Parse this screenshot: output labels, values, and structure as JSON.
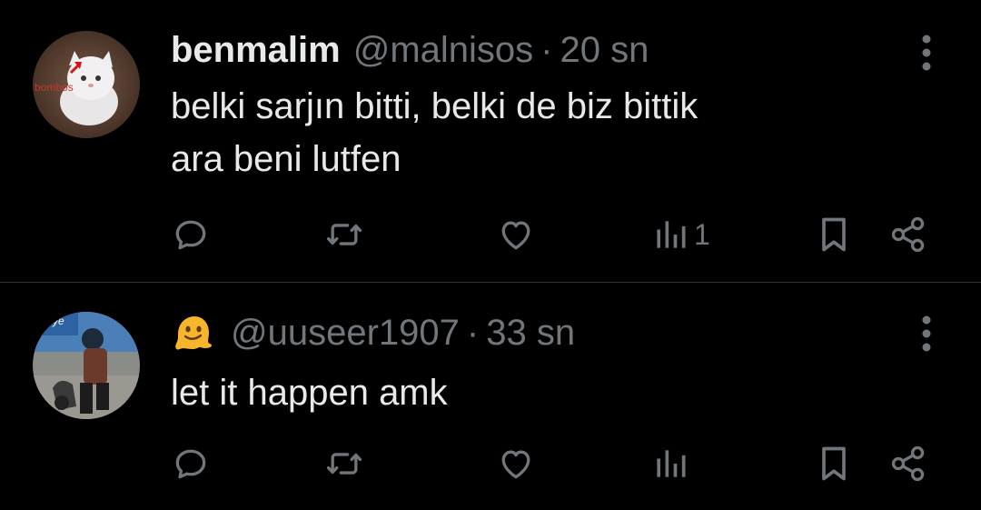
{
  "colors": {
    "background": "#000000",
    "text_primary": "#e7e9ea",
    "text_secondary": "#71767b",
    "divider": "#2f3336"
  },
  "tweets": [
    {
      "display_name": "benmalim",
      "handle": "@malnisos",
      "separator": "·",
      "time": "20 sn",
      "avatar_text": "bombos",
      "body": [
        "belki sarjın bitti, belki de biz bittik",
        "ara beni lutfen"
      ],
      "views": "1",
      "icons": [
        "reply-icon",
        "retweet-icon",
        "like-icon",
        "views-icon",
        "bookmark-icon",
        "share-icon",
        "more-icon"
      ]
    },
    {
      "display_name_emoji": "melting-face-emoji",
      "handle": "@uuseer1907",
      "separator": "·",
      "time": "33 sn",
      "avatar_text": "ye",
      "body": [
        "let it happen amk"
      ],
      "views": "",
      "icons": [
        "reply-icon",
        "retweet-icon",
        "like-icon",
        "views-icon",
        "bookmark-icon",
        "share-icon",
        "more-icon"
      ]
    }
  ]
}
